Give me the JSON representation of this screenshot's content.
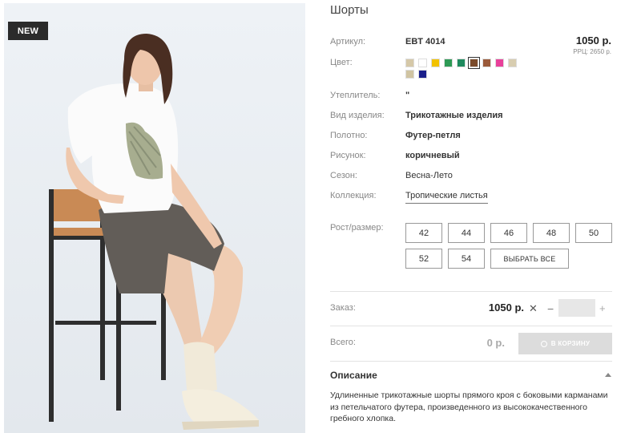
{
  "badge": "NEW",
  "product": {
    "title": "Шорты",
    "sku_label": "Артикул:",
    "sku_value": "EBT 4014",
    "price": "1050 р.",
    "rrp": "РРЦ: 2650 р.",
    "color_label": "Цвет:",
    "colors": [
      "#d5c8a8",
      "#ffffff",
      "#f2c200",
      "#2e9a55",
      "#1f8a5e",
      "#7a4a2a",
      "#9a5a3a",
      "#e8409a",
      "#d8cdb0",
      "#d0c4a2",
      "#1a1f8a"
    ],
    "selected_color_index": 5,
    "insulation_label": "Утеплитель:",
    "insulation_value": "\"",
    "type_label": "Вид изделия:",
    "type_value": "Трикотажные изделия",
    "fabric_label": "Полотно:",
    "fabric_value": "Футер-петля",
    "pattern_label": "Рисунок:",
    "pattern_value": "коричневый",
    "season_label": "Сезон:",
    "season_value": "Весна-Лето",
    "collection_label": "Коллекция:",
    "collection_value": "Тропические листья"
  },
  "sizes": {
    "label": "Рост/размер:",
    "options": [
      "42",
      "44",
      "46",
      "48",
      "50",
      "52",
      "54"
    ],
    "select_all": "ВЫБРАТЬ ВСЕ"
  },
  "order": {
    "label": "Заказ:",
    "price": "1050 р.",
    "remove_symbol": "✕",
    "minus": "−",
    "quantity": "",
    "plus": "+"
  },
  "total": {
    "label": "Всего:",
    "value": "0 р.",
    "cart_button": "В КОРЗИНУ"
  },
  "description": {
    "title": "Описание",
    "text": "Удлиненные трикотажные шорты прямого кроя с боковыми карманами из петельчатого футера, произведенного из высококачественного гребного хлопка."
  }
}
